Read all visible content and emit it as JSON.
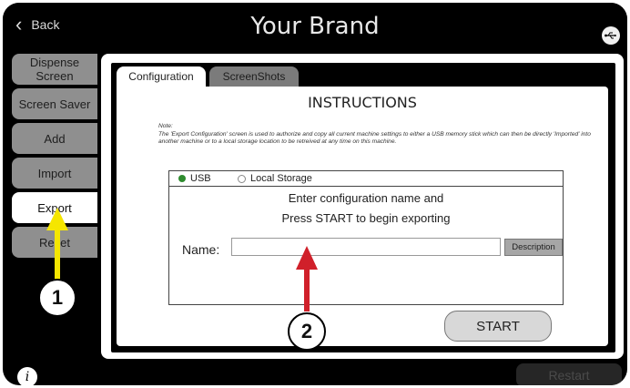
{
  "header": {
    "back_label": "Back",
    "brand_title": "Your Brand",
    "usb_icon": "usb-icon"
  },
  "sidebar": {
    "items": [
      {
        "label": "Dispense Screen",
        "active": false
      },
      {
        "label": "Screen Saver",
        "active": false
      },
      {
        "label": "Add",
        "active": false
      },
      {
        "label": "Import",
        "active": false
      },
      {
        "label": "Export",
        "active": true
      },
      {
        "label": "Reset",
        "active": false
      }
    ]
  },
  "tabs": [
    {
      "label": "Configuration",
      "active": true
    },
    {
      "label": "ScreenShots",
      "active": false
    }
  ],
  "content": {
    "title": "INSTRUCTIONS",
    "note_label": "Note:",
    "note_text": "The 'Export Configuration' screen is used to authorize and copy all current machine settings to either a USB memory stick which can then be directly 'Imported' into another machine or to a local storage location to be retreived at any time on this machine.",
    "radio_usb": "USB",
    "radio_local": "Local Storage",
    "prompt_line1": "Enter configuration name and",
    "prompt_line2": "Press START to begin exporting",
    "name_label": "Name:",
    "name_value": "",
    "description_label": "Description",
    "start_label": "START"
  },
  "footer": {
    "info_label": "i",
    "restart_label": "Restart"
  },
  "annotations": {
    "callout1": "1",
    "callout2": "2",
    "arrow1_color": "#f5e600",
    "arrow2_color": "#d0202a"
  }
}
